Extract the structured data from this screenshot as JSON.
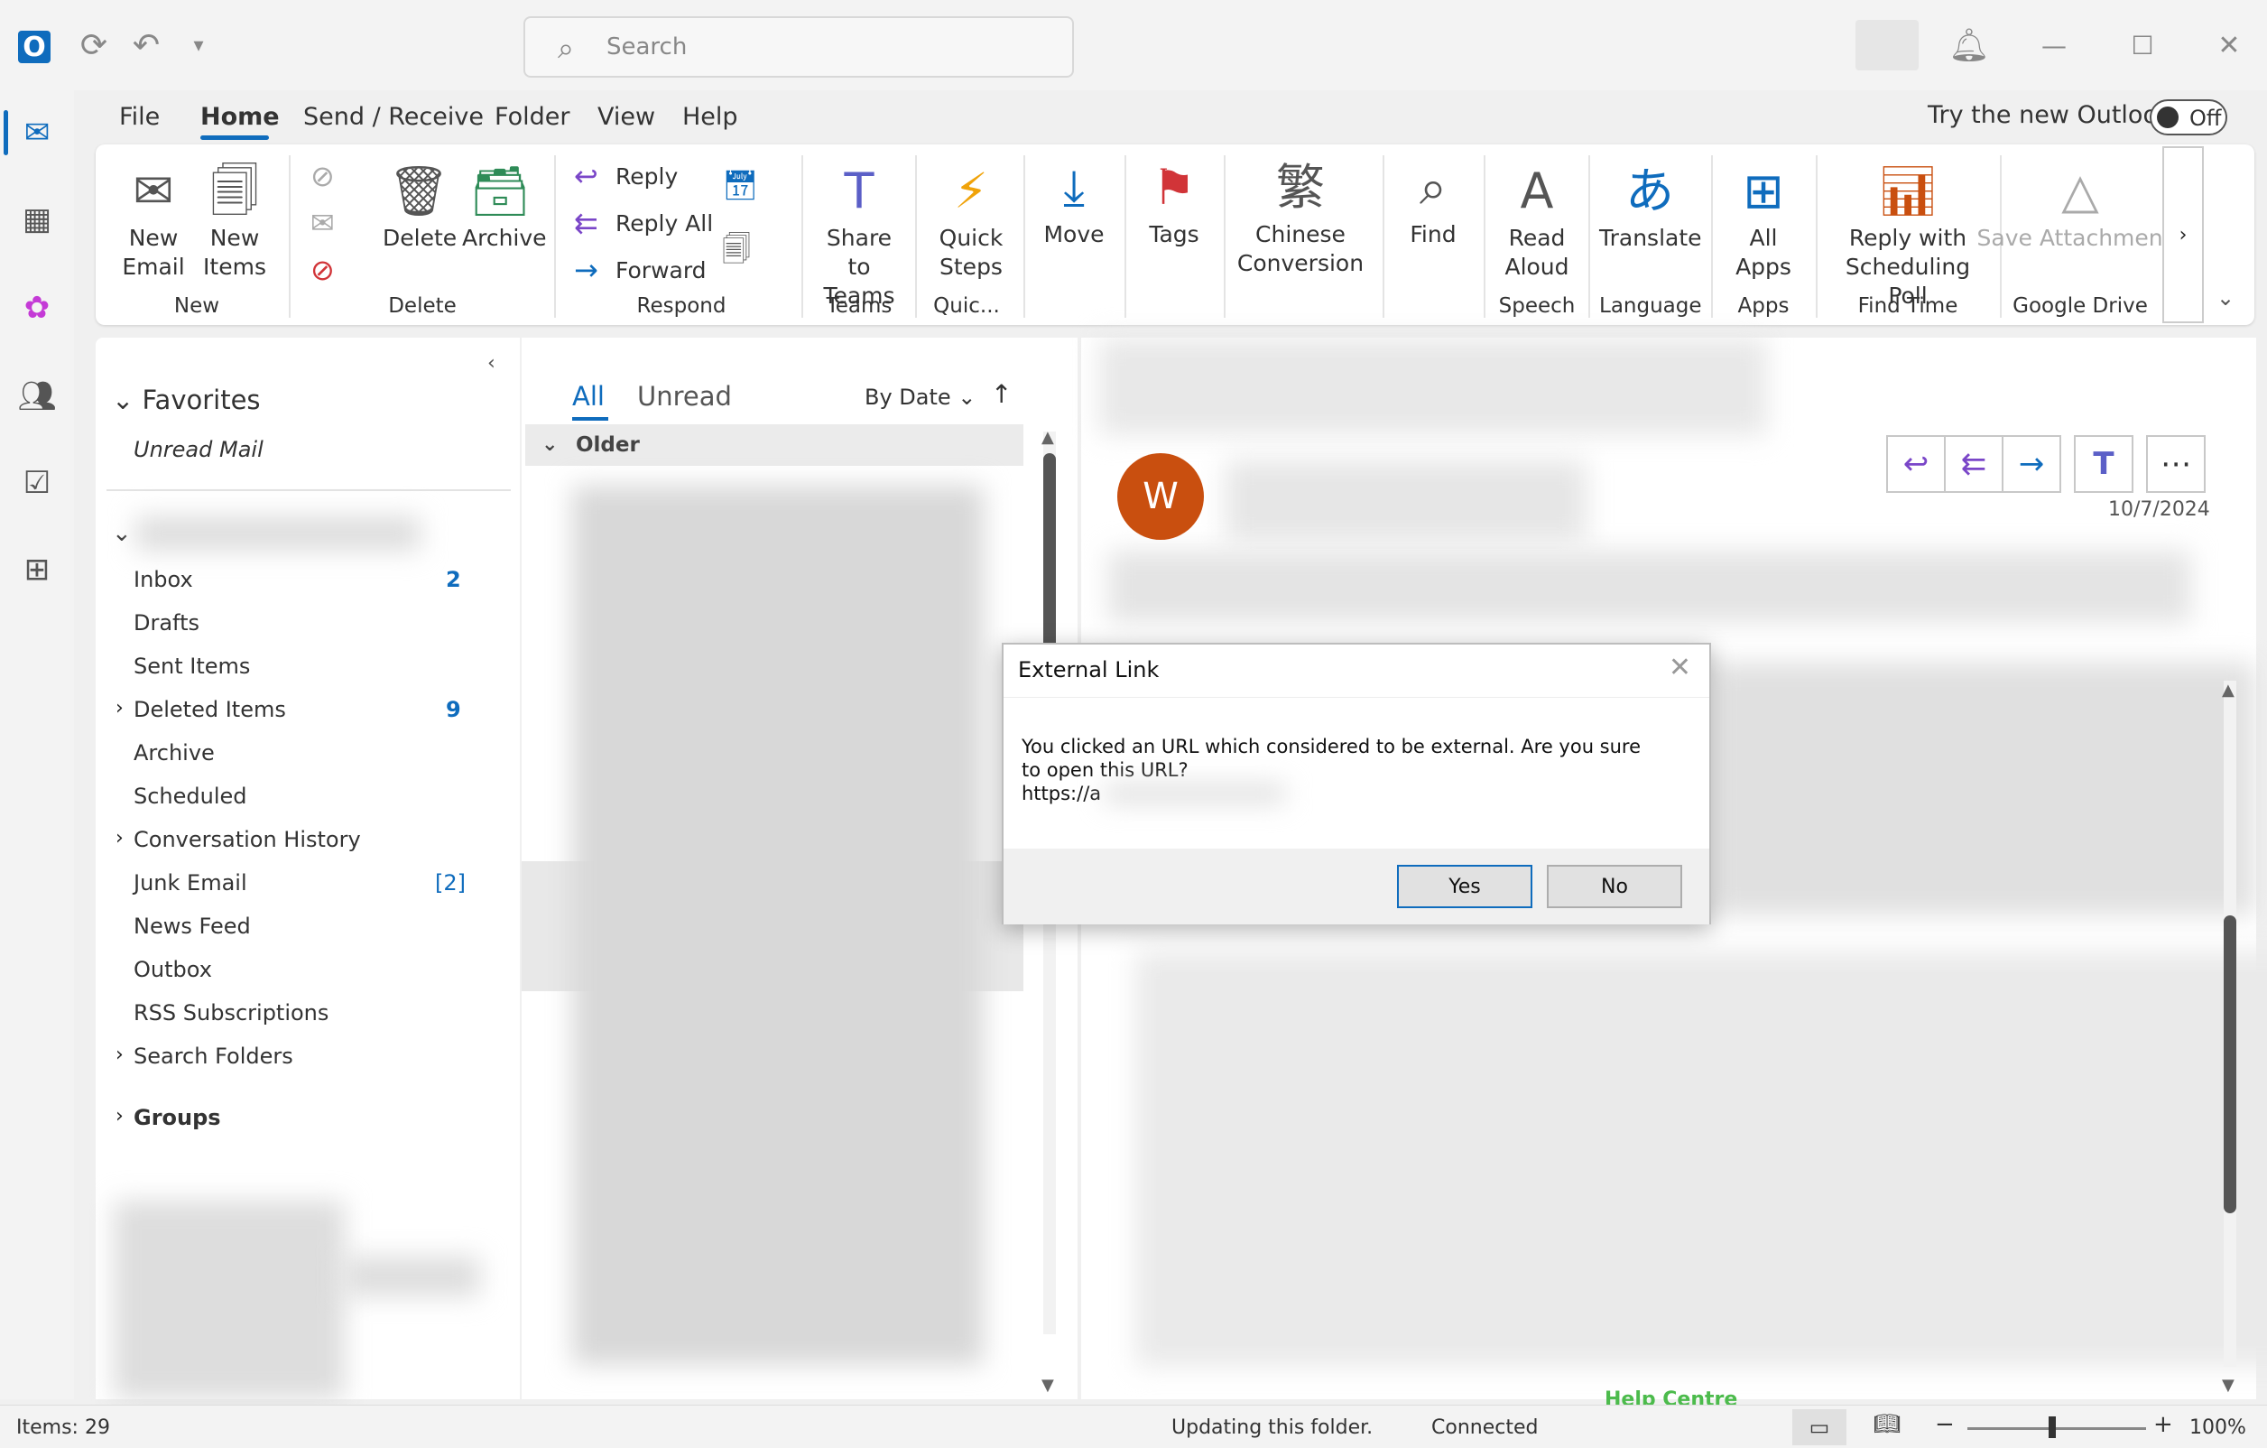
{
  "titlebar": {
    "search_placeholder": "Search"
  },
  "menu": {
    "tabs": [
      "File",
      "Home",
      "Send / Receive",
      "Folder",
      "View",
      "Help"
    ],
    "try_new": "Try the new Outlook",
    "toggle": "Off"
  },
  "ribbon": {
    "new_email": "New Email",
    "new_items": "New Items",
    "delete": "Delete",
    "archive": "Archive",
    "reply": "Reply",
    "reply_all": "Reply All",
    "forward": "Forward",
    "share_teams": "Share to Teams",
    "quick_steps": "Quick Steps",
    "move": "Move",
    "tags": "Tags",
    "chinese_conversion": "Chinese Conversion",
    "find": "Find",
    "read_aloud": "Read Aloud",
    "translate": "Translate",
    "all_apps": "All Apps",
    "reply_poll": "Reply with Scheduling Poll",
    "save_attachments": "Save Attachments",
    "groups": {
      "new": "New",
      "delete": "Delete",
      "respond": "Respond",
      "teams": "Teams",
      "quick": "Quic...",
      "speech": "Speech",
      "language": "Language",
      "apps": "Apps",
      "find_time": "Find Time",
      "google_drive": "Google Drive"
    }
  },
  "folders": {
    "favorites": "Favorites",
    "unread_mail": "Unread Mail",
    "items": [
      {
        "name": "Inbox",
        "count": "2"
      },
      {
        "name": "Drafts",
        "count": ""
      },
      {
        "name": "Sent Items",
        "count": ""
      },
      {
        "name": "Deleted Items",
        "count": "9"
      },
      {
        "name": "Archive",
        "count": ""
      },
      {
        "name": "Scheduled",
        "count": ""
      },
      {
        "name": "Conversation History",
        "count": ""
      },
      {
        "name": "Junk Email",
        "count": "[2]"
      },
      {
        "name": "News Feed",
        "count": ""
      },
      {
        "name": "Outbox",
        "count": ""
      },
      {
        "name": "RSS Subscriptions",
        "count": ""
      },
      {
        "name": "Search Folders",
        "count": ""
      }
    ],
    "groups": "Groups"
  },
  "messagelist": {
    "tab_all": "All",
    "tab_unread": "Unread",
    "sort": "By Date",
    "older": "Older"
  },
  "reading": {
    "avatar_letter": "W",
    "date": "10/7/2024",
    "footer_text": "Help Centre"
  },
  "dialog": {
    "title": "External Link",
    "message": "You clicked an URL which considered to be external. Are you sure to open this URL?",
    "url": "https://a",
    "yes": "Yes",
    "no": "No"
  },
  "status": {
    "items": "Items: 29",
    "updating": "Updating this folder.",
    "connected": "Connected",
    "zoom": "100%"
  }
}
